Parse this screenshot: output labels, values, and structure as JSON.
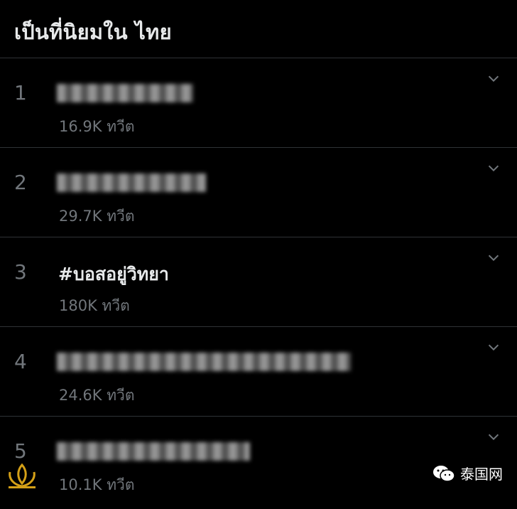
{
  "header": {
    "title": "เป็นที่นิยมใน ไทย"
  },
  "trends": [
    {
      "rank": "1",
      "topic": "",
      "blurred": true,
      "count": "16.9K ทวีต"
    },
    {
      "rank": "2",
      "topic": "",
      "blurred": true,
      "count": "29.7K ทวีต"
    },
    {
      "rank": "3",
      "topic": "#บอสอยู่วิทยา",
      "blurred": false,
      "count": "180K ทวีต"
    },
    {
      "rank": "4",
      "topic": "",
      "blurred": true,
      "count": "24.6K ทวีต"
    },
    {
      "rank": "5",
      "topic": "",
      "blurred": true,
      "count": "10.1K ทวีต"
    }
  ],
  "icons": {
    "more": "chevron-down-icon",
    "logo": "lotus-logo-icon",
    "wechat": "wechat-icon"
  },
  "watermark": {
    "text": "泰国网"
  },
  "colors": {
    "background": "#000000",
    "primary_text": "#e7e9ea",
    "secondary_text": "#71767b",
    "divider": "#2f3336"
  }
}
